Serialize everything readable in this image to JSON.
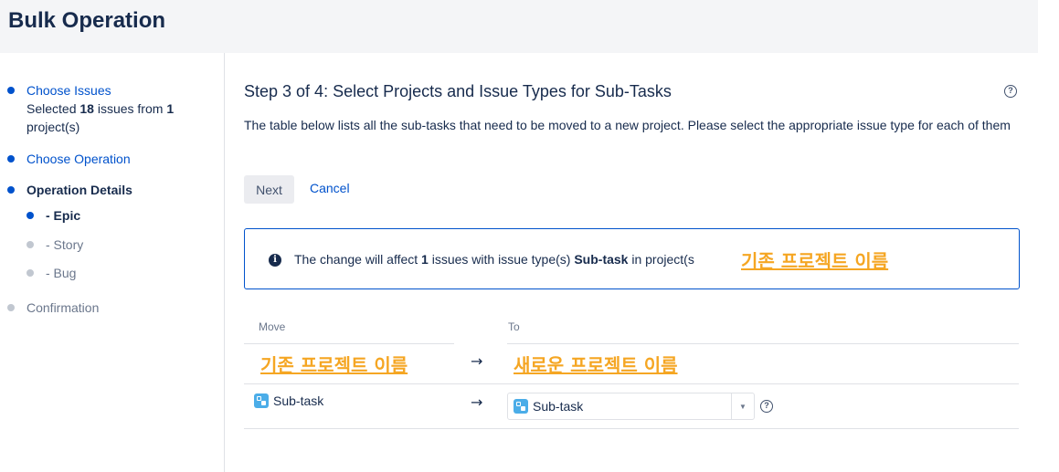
{
  "header": {
    "title": "Bulk Operation"
  },
  "sidebar": {
    "choose_issues": "Choose Issues",
    "selected_prefix": "Selected ",
    "selected_count": "18",
    "selected_mid": " issues from ",
    "project_count": "1",
    "selected_suffix": "project(s)",
    "choose_operation": "Choose Operation",
    "operation_details": "Operation Details",
    "sub_epic": "- Epic",
    "sub_story": "- Story",
    "sub_bug": "- Bug",
    "confirmation": "Confirmation"
  },
  "main": {
    "step_title": "Step 3 of 4: Select Projects and Issue Types for Sub-Tasks",
    "help_glyph": "?",
    "description": "The table below lists all the sub-tasks that need to be moved to a new project. Please select the appropriate issue type for each of them",
    "next_label": "Next",
    "cancel_label": "Cancel"
  },
  "info": {
    "icon_glyph": "i",
    "text_prefix": "The change will affect ",
    "count": "1",
    "text_mid": " issues with issue type(s) ",
    "type": "Sub-task",
    "text_suffix": " in project(s",
    "highlight": "기존 프로젝트 이름"
  },
  "table": {
    "col_move": "Move",
    "col_to": "To",
    "old_project": "기존 프로젝트 이름",
    "arrow": "→",
    "new_project": "새로운 프로젝트 이름",
    "row_from_type": "Sub-task",
    "row_to_type": "Sub-task",
    "dropdown_glyph": "▼"
  },
  "colors": {
    "accent": "#0052cc",
    "highlight": "#f5a623",
    "subtask_icon": "#4bade8"
  }
}
